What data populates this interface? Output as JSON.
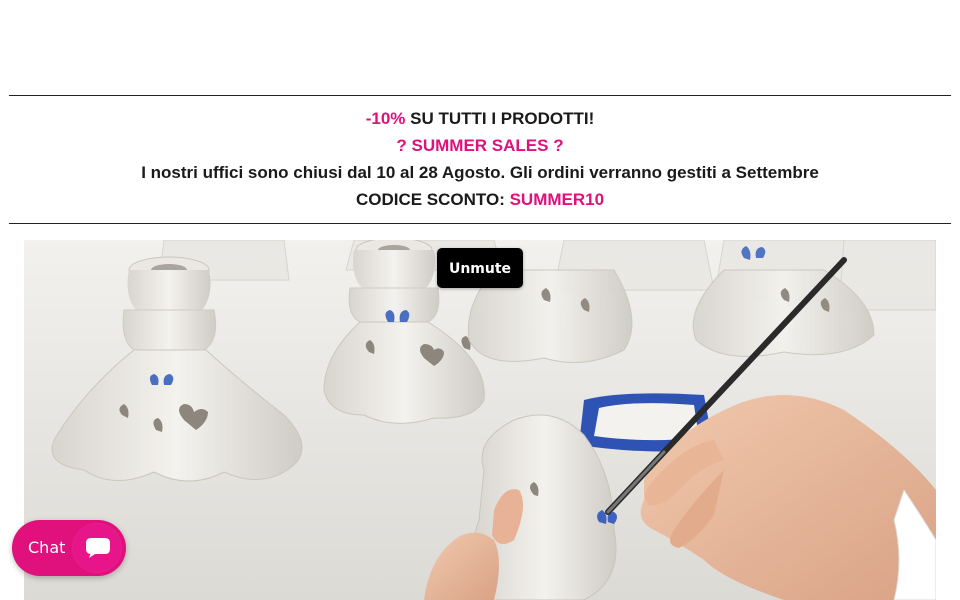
{
  "announcement": {
    "line1_highlight": "-10%",
    "line1_rest": " SU TUTTI I PRODOTTI!",
    "line2_left_icon": "?",
    "line2_text": " SUMMER SALES ",
    "line2_right_icon": "?",
    "line3": "I nostri uffici sono chiusi dal 10 al 28 Agosto. Gli ordini verranno gestiti a Settembre",
    "line4_label": "CODICE SCONTO: ",
    "line4_code": "SUMMER10"
  },
  "video": {
    "unmute_label": "Unmute",
    "scene": "ceramic-painting-image"
  },
  "chat": {
    "label": "Chat",
    "icon": "chat-bubble-icon"
  },
  "colors": {
    "accent": "#e0107d",
    "text": "#1a1a1a",
    "button_bg": "#000000"
  }
}
